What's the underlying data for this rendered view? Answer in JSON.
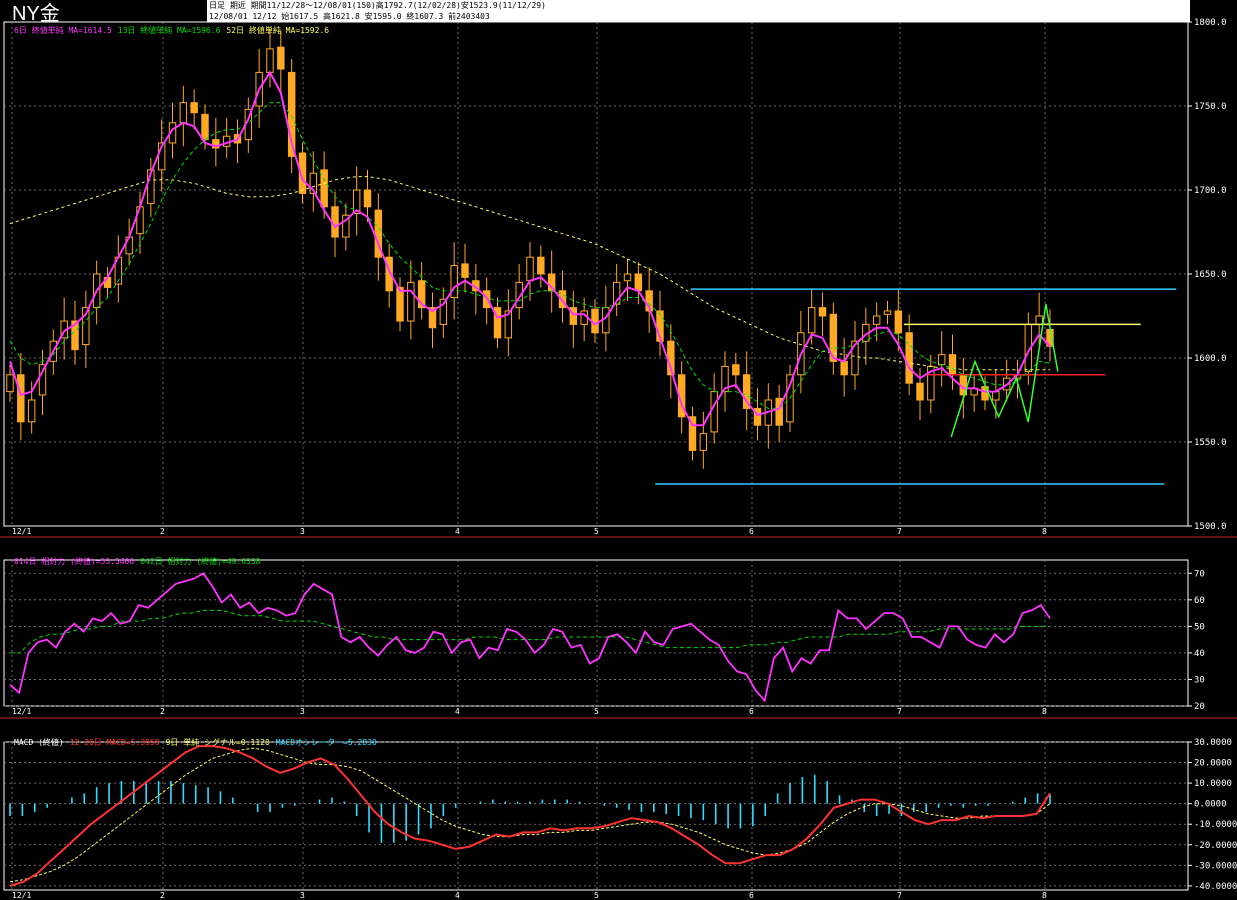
{
  "header": {
    "title": "NY金",
    "info_line1": "日足 期近 期間11/12/28～12/08/01(150)高1792.7(12/02/28)安1523.9(11/12/29)",
    "info_line2": "12/08/01 12/12 始1617.5 高1621.8 安1595.0 終1607.3 前2403403"
  },
  "legends": {
    "price": [
      {
        "text": "6日 終値単純 MA=1614.5",
        "color": "#ff33ff"
      },
      {
        "text": "13日 終値単純 MA=1596.6",
        "color": "#00dd00"
      },
      {
        "text": "52日 終値単純 MA=1592.6",
        "color": "#ffff66"
      }
    ],
    "rsi": [
      {
        "text": "014日 相対力 (終値)=53.5406",
        "color": "#ff33ff"
      },
      {
        "text": "042日 相対力 (終値)=49.6338",
        "color": "#00dd00"
      }
    ],
    "macd": [
      {
        "text": "MACD (終値)",
        "color": "#ffffff"
      },
      {
        "text": "12-26日 MACD=5.3950",
        "color": "#ff3333"
      },
      {
        "text": "9日 単純 シグナル=0.1120",
        "color": "#ffff66"
      },
      {
        "text": "MACDオシレーター=5.2830",
        "color": "#33ddff"
      }
    ]
  },
  "chart_data": [
    {
      "type": "candlestick",
      "name": "price",
      "ylim": [
        1500,
        1800
      ],
      "y_ticks": [
        "1800.0",
        "1750.0",
        "1700.0",
        "1650.0",
        "1600.0",
        "1550.0",
        "1500.0"
      ],
      "x_ticks": [
        "12/1",
        "2",
        "3",
        "4",
        "5",
        "6",
        "7",
        "8"
      ],
      "candle_color": "#ffaa22",
      "close": [
        1590,
        1562,
        1575,
        1596,
        1610,
        1622,
        1605,
        1630,
        1650,
        1642,
        1660,
        1672,
        1690,
        1712,
        1728,
        1740,
        1752,
        1746,
        1730,
        1725,
        1732,
        1728,
        1748,
        1770,
        1784,
        1772,
        1720,
        1698,
        1710,
        1690,
        1672,
        1685,
        1700,
        1690,
        1660,
        1640,
        1622,
        1645,
        1630,
        1618,
        1635,
        1655,
        1648,
        1640,
        1630,
        1612,
        1628,
        1645,
        1660,
        1650,
        1640,
        1630,
        1620,
        1628,
        1615,
        1630,
        1645,
        1650,
        1640,
        1628,
        1610,
        1590,
        1565,
        1545,
        1555,
        1580,
        1595,
        1590,
        1570,
        1560,
        1575,
        1560,
        1590,
        1615,
        1630,
        1625,
        1598,
        1590,
        1610,
        1620,
        1625,
        1628,
        1615,
        1585,
        1575,
        1595,
        1602,
        1590,
        1578,
        1582,
        1575,
        1580,
        1588,
        1590,
        1620,
        1625,
        1607
      ],
      "open": [
        1580,
        1590,
        1562,
        1578,
        1598,
        1612,
        1622,
        1608,
        1630,
        1648,
        1644,
        1662,
        1674,
        1692,
        1712,
        1728,
        1740,
        1752,
        1745,
        1730,
        1726,
        1733,
        1730,
        1750,
        1770,
        1785,
        1770,
        1722,
        1698,
        1712,
        1690,
        1672,
        1686,
        1700,
        1688,
        1660,
        1642,
        1622,
        1646,
        1630,
        1620,
        1636,
        1656,
        1646,
        1640,
        1630,
        1612,
        1630,
        1646,
        1660,
        1650,
        1640,
        1630,
        1620,
        1629,
        1615,
        1632,
        1646,
        1650,
        1640,
        1628,
        1610,
        1590,
        1565,
        1545,
        1556,
        1580,
        1596,
        1590,
        1570,
        1560,
        1576,
        1562,
        1590,
        1615,
        1630,
        1626,
        1598,
        1590,
        1610,
        1620,
        1626,
        1628,
        1615,
        1585,
        1575,
        1596,
        1602,
        1590,
        1578,
        1583,
        1575,
        1581,
        1588,
        1592,
        1620,
        1617
      ],
      "ma_short": [
        1598,
        1578,
        1580,
        1592,
        1604,
        1616,
        1620,
        1626,
        1640,
        1648,
        1660,
        1672,
        1690,
        1710,
        1726,
        1736,
        1740,
        1738,
        1728,
        1726,
        1728,
        1730,
        1742,
        1760,
        1770,
        1758,
        1728,
        1706,
        1700,
        1688,
        1678,
        1682,
        1688,
        1684,
        1668,
        1652,
        1640,
        1640,
        1632,
        1628,
        1632,
        1642,
        1646,
        1642,
        1636,
        1624,
        1626,
        1636,
        1646,
        1648,
        1642,
        1634,
        1626,
        1626,
        1620,
        1624,
        1634,
        1642,
        1640,
        1630,
        1612,
        1594,
        1572,
        1560,
        1560,
        1572,
        1582,
        1584,
        1574,
        1566,
        1568,
        1570,
        1584,
        1602,
        1614,
        1612,
        1600,
        1598,
        1608,
        1614,
        1618,
        1618,
        1608,
        1594,
        1588,
        1592,
        1594,
        1588,
        1582,
        1582,
        1580,
        1580,
        1584,
        1590,
        1604,
        1614,
        1607
      ],
      "ma_mid": [
        1610,
        1600,
        1596,
        1598,
        1602,
        1610,
        1616,
        1622,
        1630,
        1636,
        1646,
        1656,
        1668,
        1680,
        1694,
        1706,
        1716,
        1724,
        1730,
        1734,
        1736,
        1736,
        1740,
        1746,
        1752,
        1752,
        1744,
        1730,
        1718,
        1706,
        1696,
        1690,
        1688,
        1684,
        1678,
        1668,
        1660,
        1654,
        1648,
        1642,
        1640,
        1640,
        1640,
        1638,
        1636,
        1634,
        1634,
        1634,
        1638,
        1640,
        1640,
        1638,
        1634,
        1632,
        1630,
        1630,
        1632,
        1636,
        1636,
        1632,
        1626,
        1616,
        1604,
        1592,
        1584,
        1580,
        1580,
        1580,
        1578,
        1574,
        1570,
        1570,
        1576,
        1586,
        1596,
        1604,
        1606,
        1606,
        1608,
        1610,
        1614,
        1616,
        1614,
        1608,
        1602,
        1598,
        1596,
        1594,
        1590,
        1588,
        1586,
        1584,
        1584,
        1586,
        1592,
        1598,
        1597
      ],
      "ma_long": [
        1680,
        1682,
        1684,
        1686,
        1688,
        1690,
        1692,
        1694,
        1696,
        1698,
        1700,
        1702,
        1704,
        1706,
        1706,
        1706,
        1705,
        1704,
        1702,
        1700,
        1698,
        1697,
        1696,
        1696,
        1696,
        1697,
        1698,
        1700,
        1702,
        1704,
        1706,
        1707,
        1708,
        1708,
        1707,
        1706,
        1704,
        1702,
        1700,
        1698,
        1696,
        1694,
        1692,
        1690,
        1688,
        1686,
        1684,
        1682,
        1680,
        1678,
        1676,
        1674,
        1672,
        1670,
        1668,
        1665,
        1662,
        1659,
        1656,
        1653,
        1650,
        1646,
        1642,
        1638,
        1634,
        1630,
        1627,
        1624,
        1621,
        1618,
        1615,
        1612,
        1610,
        1608,
        1606,
        1604,
        1603,
        1602,
        1601,
        1600,
        1600,
        1599,
        1598,
        1597,
        1596,
        1595,
        1594,
        1594,
        1593,
        1593,
        1593,
        1593,
        1593,
        1593,
        1593,
        1593,
        1593
      ],
      "hlines": [
        {
          "y": 1641,
          "from": 0.58,
          "to": 0.99,
          "color": "#33ccff"
        },
        {
          "y": 1525,
          "from": 0.55,
          "to": 0.98,
          "color": "#33ccff"
        },
        {
          "y": 1620,
          "from": 0.76,
          "to": 0.96,
          "color": "#ffff66"
        },
        {
          "y": 1590,
          "from": 0.78,
          "to": 0.93,
          "color": "#ff2222"
        }
      ],
      "zigzag": [
        [
          0.8,
          1553
        ],
        [
          0.82,
          1598
        ],
        [
          0.84,
          1565
        ],
        [
          0.855,
          1588
        ],
        [
          0.865,
          1562
        ],
        [
          0.88,
          1632
        ],
        [
          0.89,
          1592
        ]
      ]
    },
    {
      "type": "line",
      "name": "rsi",
      "ylim": [
        20,
        75
      ],
      "y_ticks": [
        "70",
        "60",
        "50",
        "40",
        "30",
        "20"
      ],
      "x_ticks": [
        "12/1",
        "2",
        "3",
        "4",
        "5",
        "6",
        "7",
        "8"
      ],
      "series": [
        {
          "name": "014日 相対力 (終値)",
          "color": "#ff33ff",
          "values": [
            28,
            25,
            40,
            44,
            45,
            42,
            48,
            51,
            48,
            53,
            52,
            55,
            51,
            52,
            58,
            57,
            60,
            63,
            66,
            67,
            68,
            70,
            65,
            59,
            62,
            57,
            59,
            55,
            57,
            56,
            54,
            55,
            62,
            66,
            64,
            62,
            46,
            44,
            46,
            42,
            39,
            43,
            46,
            41,
            40,
            42,
            48,
            47,
            40,
            44,
            45,
            38,
            42,
            41,
            49,
            48,
            45,
            40,
            43,
            49,
            48,
            42,
            43,
            36,
            38,
            46,
            47,
            44,
            40,
            48,
            44,
            43,
            49,
            50,
            51,
            48,
            45,
            43,
            37,
            33,
            32,
            26,
            22,
            38,
            42,
            33,
            38,
            36,
            41,
            41,
            56,
            53,
            53,
            49,
            52,
            55,
            55,
            53,
            46,
            46,
            44,
            42,
            50,
            50,
            45,
            43,
            42,
            47,
            44,
            47,
            55,
            56,
            58,
            53
          ]
        },
        {
          "name": "042日 相対力 (終値)",
          "color": "#00dd00",
          "values": [
            40,
            40,
            44,
            46,
            47,
            47,
            48,
            49,
            49,
            50,
            50,
            52,
            52,
            52,
            53,
            53,
            54,
            55,
            55,
            56,
            56,
            56,
            55,
            54,
            54,
            54,
            53,
            52,
            52,
            52,
            52,
            51,
            50,
            49,
            48,
            47,
            46,
            46,
            45,
            45,
            45,
            45,
            45,
            45,
            45,
            45,
            46,
            46,
            46,
            45,
            45,
            45,
            45,
            45,
            46,
            46,
            46,
            46,
            46,
            46,
            46,
            46,
            45,
            44,
            43,
            42,
            42,
            42,
            42,
            42,
            42,
            42,
            42,
            43,
            43,
            43,
            44,
            44,
            45,
            46,
            46,
            46,
            46,
            47,
            47,
            47,
            47,
            47,
            48,
            48,
            48,
            48,
            49,
            49,
            49,
            49,
            49,
            49,
            49,
            49,
            50,
            50,
            50,
            50
          ]
        }
      ]
    },
    {
      "type": "line",
      "name": "macd",
      "ylim": [
        -42,
        30
      ],
      "y_ticks": [
        "30.0000",
        "20.0000",
        "10.0000",
        "0.0000",
        "-10.0000",
        "-20.0000",
        "-30.0000",
        "-40.0000"
      ],
      "x_ticks": [
        "12/1",
        "2",
        "3",
        "4",
        "5",
        "6",
        "7",
        "8"
      ],
      "series": [
        {
          "name": "12-26日 MACD",
          "color": "#ff3333",
          "values": [
            -40,
            -38,
            -34,
            -28,
            -22,
            -16,
            -10,
            -5,
            0,
            5,
            10,
            15,
            20,
            25,
            28,
            28,
            27,
            25,
            22,
            18,
            15,
            17,
            20,
            22,
            19,
            12,
            4,
            -4,
            -10,
            -14,
            -17,
            -18,
            -20,
            -22,
            -21,
            -18,
            -15,
            -16,
            -14,
            -14,
            -12,
            -13,
            -12,
            -12,
            -11,
            -9,
            -7,
            -8,
            -9,
            -12,
            -16,
            -20,
            -25,
            -29,
            -29,
            -27,
            -25,
            -25,
            -22,
            -17,
            -10,
            -2,
            0,
            2,
            2,
            0,
            -4,
            -8,
            -10,
            -8,
            -8,
            -6,
            -7,
            -6,
            -6,
            -6,
            -5,
            5
          ]
        },
        {
          "name": "9日 単純 シグナル",
          "color": "#ffff66",
          "values": [
            -38,
            -37,
            -35,
            -33,
            -30,
            -26,
            -21,
            -16,
            -11,
            -6,
            -1,
            4,
            9,
            14,
            18,
            22,
            24,
            26,
            27,
            26,
            24,
            22,
            20,
            19,
            19,
            18,
            16,
            12,
            8,
            4,
            0,
            -4,
            -8,
            -11,
            -13,
            -15,
            -16,
            -16,
            -15,
            -15,
            -14,
            -14,
            -13,
            -13,
            -12,
            -11,
            -10,
            -9,
            -9,
            -10,
            -12,
            -14,
            -17,
            -20,
            -22,
            -24,
            -25,
            -24,
            -22,
            -19,
            -14,
            -9,
            -5,
            -2,
            0,
            0,
            -1,
            -3,
            -5,
            -6,
            -7,
            -7,
            -6,
            -6,
            -6,
            -6,
            -5,
            0
          ]
        },
        {
          "name": "MACDオシレーター",
          "color": "#33ddff",
          "values": [
            -6,
            -6,
            -4,
            -2,
            0,
            3,
            5,
            8,
            10,
            11,
            11,
            11,
            11,
            11,
            10,
            9,
            8,
            6,
            3,
            0,
            -4,
            -4,
            -2,
            -1,
            0,
            2,
            3,
            1,
            -6,
            -14,
            -19,
            -19,
            -18,
            -15,
            -12,
            -6,
            -2,
            0,
            1,
            2,
            1,
            1,
            1,
            2,
            2,
            2,
            1,
            0,
            -1,
            -2,
            -3,
            -4,
            -4,
            -5,
            -6,
            -7,
            -8,
            -10,
            -12,
            -12,
            -11,
            -6,
            5,
            10,
            13,
            14,
            11,
            4,
            2,
            -4,
            -6,
            -5,
            -6,
            -4,
            -4,
            -2,
            -1,
            -2,
            -1,
            -1,
            0,
            1,
            3,
            5,
            5
          ]
        }
      ]
    }
  ]
}
